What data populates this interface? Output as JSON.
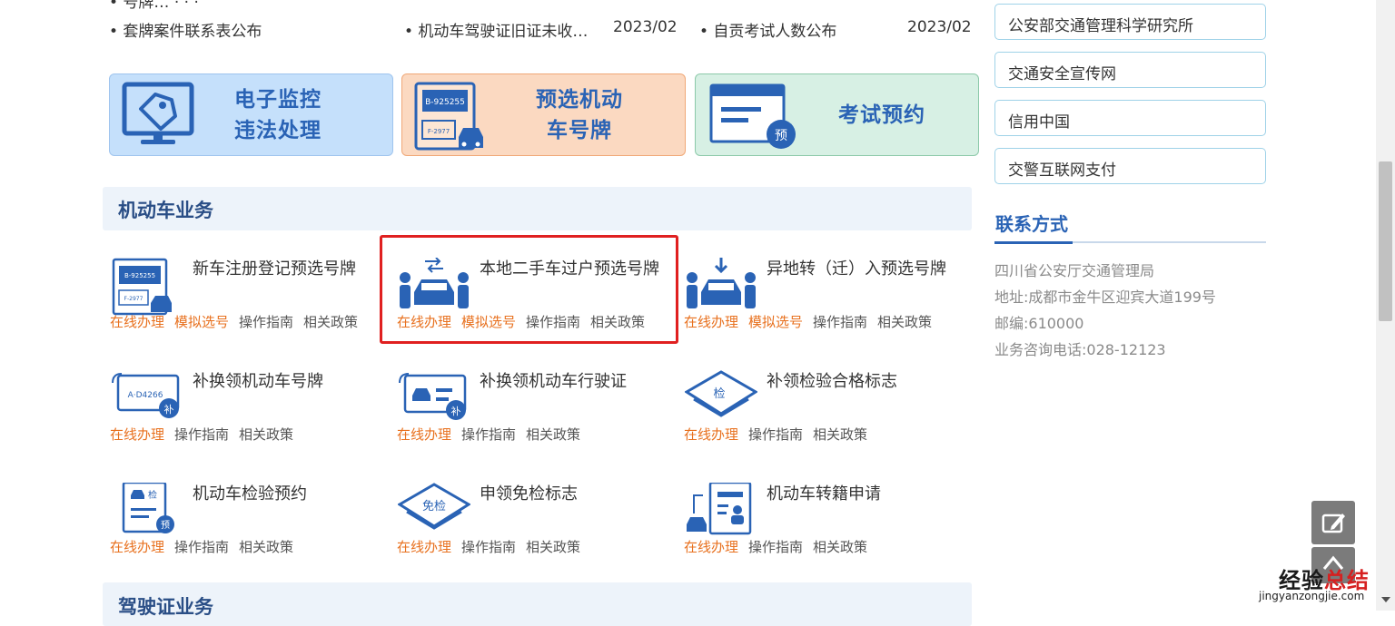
{
  "news": {
    "items": [
      {
        "text": "• 套牌案件联系表公布",
        "date": ""
      },
      {
        "text": "• 机动车驾驶证旧证未收…",
        "date": "2023/02"
      },
      {
        "text": "• 自贡考试人数公布",
        "date": "2023/02"
      }
    ]
  },
  "banners": [
    {
      "title": "电子监控\n违法处理",
      "icon": "monitor-tag-icon",
      "bg": "#c5e0fb"
    },
    {
      "title": "预选机动\n车号牌",
      "icon": "license-plate-car-icon",
      "bg": "#fbd9c1",
      "plate_top": "B-925255",
      "plate_bottom": "F-2977"
    },
    {
      "title": "考试预约",
      "icon": "document-reserve-icon",
      "bg": "#d7f0e4",
      "badge": "预"
    }
  ],
  "sections": [
    {
      "title": "机动车业务"
    },
    {
      "title": "驾驶证业务"
    }
  ],
  "services": [
    {
      "title": "新车注册登记预选号牌",
      "icon": "license-plate-car-icon",
      "links": [
        "在线办理",
        "模拟选号",
        "操作指南",
        "相关政策"
      ],
      "plate_top": "B-925255",
      "plate_bottom": "F-2977"
    },
    {
      "title": "本地二手车过户预选号牌",
      "icon": "car-transfer-icon",
      "links": [
        "在线办理",
        "模拟选号",
        "操作指南",
        "相关政策"
      ]
    },
    {
      "title": "异地转（迁）入预选号牌",
      "icon": "car-relocate-icon",
      "links": [
        "在线办理",
        "模拟选号",
        "操作指南",
        "相关政策"
      ]
    },
    {
      "title": "补换领机动车号牌",
      "icon": "plate-replace-icon",
      "links": [
        "在线办理",
        "操作指南",
        "相关政策"
      ],
      "plate": "A·D4266",
      "badge": "补"
    },
    {
      "title": "补换领机动车行驶证",
      "icon": "license-replace-icon",
      "links": [
        "在线办理",
        "操作指南",
        "相关政策"
      ],
      "badge": "补"
    },
    {
      "title": "补领检验合格标志",
      "icon": "inspection-mark-icon",
      "links": [
        "在线办理",
        "操作指南",
        "相关政策"
      ],
      "badge": "检"
    },
    {
      "title": "机动车检验预约",
      "icon": "inspection-reserve-icon",
      "links": [
        "在线办理",
        "操作指南",
        "相关政策"
      ],
      "badge": "检",
      "badge2": "预"
    },
    {
      "title": "申领免检标志",
      "icon": "exempt-mark-icon",
      "links": [
        "在线办理",
        "操作指南",
        "相关政策"
      ],
      "badge": "免检"
    },
    {
      "title": "机动车转籍申请",
      "icon": "vehicle-transfer-icon",
      "links": [
        "在线办理",
        "操作指南",
        "相关政策"
      ]
    }
  ],
  "sidebar": {
    "links": [
      "公安部交通管理科学研究所",
      "交通安全宣传网",
      "信用中国",
      "交警互联网支付"
    ],
    "contact_title": "联系方式",
    "contact": [
      "四川省公安厅交通管理局",
      "地址:成都市金牛区迎宾大道199号",
      "邮编:610000",
      "业务咨询电话:028-12123"
    ]
  },
  "watermark": {
    "cn_a": "经验",
    "cn_b": "总结",
    "url": "jingyanzongjie.com"
  },
  "colors": {
    "brand_blue": "#2a63b5",
    "link_orange": "#e8711f",
    "highlight_red": "#e02020"
  }
}
